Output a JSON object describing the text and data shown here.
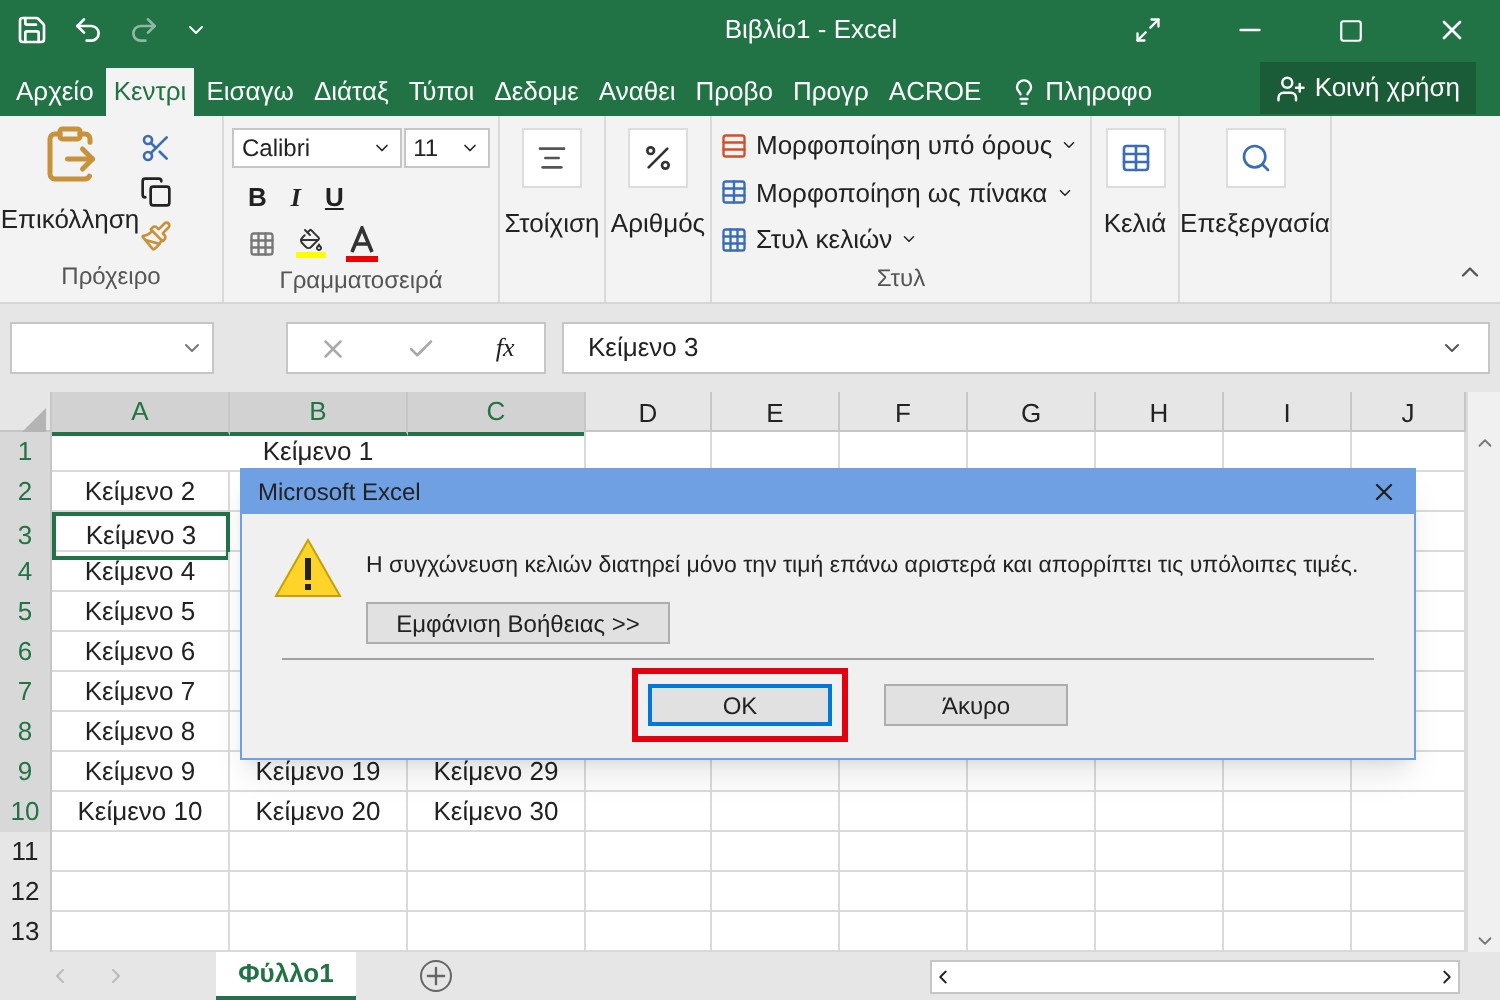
{
  "window": {
    "title": "Βιβλίο1 - Excel"
  },
  "ribbon_tabs": [
    {
      "label": "Αρχείο",
      "selected": false
    },
    {
      "label": "Κεντρι",
      "selected": true
    },
    {
      "label": "Εισαγω",
      "selected": false
    },
    {
      "label": "Διάταξ",
      "selected": false
    },
    {
      "label": "Τύποι",
      "selected": false
    },
    {
      "label": "Δεδομε",
      "selected": false
    },
    {
      "label": "Αναθει",
      "selected": false
    },
    {
      "label": "Προβο",
      "selected": false
    },
    {
      "label": "Προγρ",
      "selected": false
    },
    {
      "label": "ACROE",
      "selected": false
    }
  ],
  "tell_me": "Πληροφο",
  "share_button": "Κοινή χρήση",
  "ribbon": {
    "clipboard": {
      "paste": "Επικόλληση",
      "label": "Πρόχειρο"
    },
    "font": {
      "name": "Calibri",
      "size": "11",
      "label": "Γραμματοσειρά",
      "bold": "B",
      "italic": "I",
      "underline": "U"
    },
    "alignment": "Στοίχιση",
    "number": "Αριθμός",
    "styles": {
      "items": [
        "Μορφοποίηση υπό όρους",
        "Μορφοποίηση ως πίνακα",
        "Στυλ κελιών"
      ],
      "label": "Στυλ"
    },
    "cells": "Κελιά",
    "editing": "Επεξεργασία"
  },
  "formula_bar": {
    "function_label": "fx",
    "content": "Κείμενο 3"
  },
  "columns": [
    {
      "label": "A",
      "selected": true
    },
    {
      "label": "B",
      "selected": true
    },
    {
      "label": "C",
      "selected": true
    },
    {
      "label": "D",
      "selected": false
    },
    {
      "label": "E",
      "selected": false
    },
    {
      "label": "F",
      "selected": false
    },
    {
      "label": "G",
      "selected": false
    },
    {
      "label": "H",
      "selected": false
    },
    {
      "label": "I",
      "selected": false
    },
    {
      "label": "J",
      "selected": false
    }
  ],
  "rows": [
    {
      "header": "1",
      "selected": true,
      "active": false,
      "merged_text": "Κείμενο 1"
    },
    {
      "header": "2",
      "selected": true,
      "active": false,
      "cells": [
        "Κείμενο 2"
      ]
    },
    {
      "header": "3",
      "selected": true,
      "active": true,
      "cells": [
        "Κείμενο 3"
      ]
    },
    {
      "header": "4",
      "selected": true,
      "active": false,
      "cells": [
        "Κείμενο 4"
      ]
    },
    {
      "header": "5",
      "selected": true,
      "active": false,
      "cells": [
        "Κείμενο 5"
      ]
    },
    {
      "header": "6",
      "selected": true,
      "active": false,
      "cells": [
        "Κείμενο 6"
      ]
    },
    {
      "header": "7",
      "selected": true,
      "active": false,
      "cells": [
        "Κείμενο 7"
      ]
    },
    {
      "header": "8",
      "selected": true,
      "active": false,
      "cells": [
        "Κείμενο 8"
      ]
    },
    {
      "header": "9",
      "selected": true,
      "active": false,
      "cells": [
        "Κείμενο 9",
        "Κείμενο 19",
        "Κείμενο 29"
      ]
    },
    {
      "header": "10",
      "selected": true,
      "active": false,
      "cells": [
        "Κείμενο 10",
        "Κείμενο 20",
        "Κείμενο 30"
      ]
    },
    {
      "header": "11",
      "selected": false,
      "active": false
    },
    {
      "header": "12",
      "selected": false,
      "active": false
    },
    {
      "header": "13",
      "selected": false,
      "active": false
    }
  ],
  "dialog": {
    "title": "Microsoft Excel",
    "message": "Η συγχώνευση κελιών διατηρεί μόνο την τιμή επάνω αριστερά και απορρίπτει τις υπόλοιπες τιμές.",
    "help_button": "Εμφάνιση Βοήθειας >>",
    "buttons": [
      {
        "label": "OK",
        "default": true,
        "highlighted": true
      },
      {
        "label": "Άκυρο",
        "default": false,
        "highlighted": false
      }
    ]
  },
  "sheet_tabs": [
    {
      "label": "Φύλλο1",
      "selected": true
    }
  ]
}
